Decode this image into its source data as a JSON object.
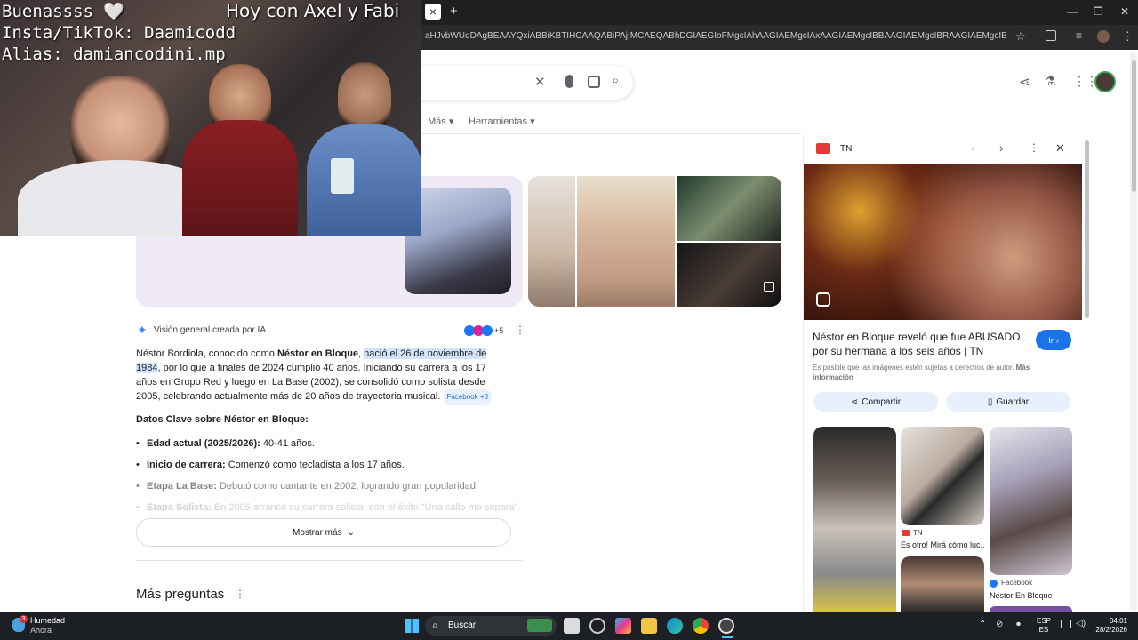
{
  "stream_overlay": {
    "line1": "Buenassss 🤍",
    "line2": "Insta/TikTok: Daamicodd",
    "line3": "Alias: damiancodini.mp",
    "title": "Hoy con Axel y Fabi"
  },
  "browser": {
    "new_tab": "+",
    "close_tab": "×",
    "url": "aHJvbWUqDAgBEAAYQxiABBiKBTIHCAAQABiPAjIMCAEQABhDGIAEGIoFMgcIAhAAGIAEMgcIAxAAGIAEMgcIBBAAGIAEMgcIBRAAGIAEMgcIBhAuGIAEMgcIBxAA..."
  },
  "search": {
    "tabs": [
      "Más",
      "Herramientas"
    ]
  },
  "ai_overview": {
    "header": "Visión general creada por IA",
    "sources_count": "+5",
    "para_part1": "Néstor Bordiola, conocido como ",
    "para_bold": "Néstor en Bloque",
    "para_part2": ", ",
    "para_highlight": "nació el 26 de noviembre de 1984",
    "para_part3": ", por lo que a finales de 2024 cumplió 40 años. Iniciando su carrera a los 17 años en Grupo Red y luego en La Base (2002), se consolidó como solista desde 2005, celebrando actualmente más de 20 años de trayectoria musical.",
    "source_chip": "Facebook +3",
    "key_title": "Datos Clave sobre Néstor en Bloque:",
    "bullets": [
      {
        "label": "Edad actual (2025/2026):",
        "text": " 40-41 años."
      },
      {
        "label": "Inicio de carrera:",
        "text": " Comenzó como tecladista a los 17 años."
      },
      {
        "label": "Etapa La Base:",
        "text": " Debutó como cantante en 2002, logrando gran popularidad."
      },
      {
        "label": "Etapa Solista:",
        "text": " En 2005 arrancó su carrera solista, con el éxito \"Una calle me separa\"."
      }
    ],
    "show_more": "Mostrar más",
    "more_questions": "Más preguntas"
  },
  "panel": {
    "source": "TN",
    "title": "Néstor en Bloque reveló que fue ABUSADO por su hermana a los seis años | TN",
    "go_button": "Ir",
    "disclaimer": "Es posible que las imágenes estén sujetas a derechos de autor.",
    "more_info": "Más información",
    "share": "Compartir",
    "save": "Guardar",
    "related": [
      {
        "source": "TN",
        "caption": "Es otro! Mirá cómo luc..."
      },
      {
        "source": "Facebook",
        "caption": "Nestor En Bloque"
      }
    ]
  },
  "taskbar": {
    "weather_title": "Humedad",
    "weather_sub": "Ahora",
    "weather_badge": "3",
    "search_label": "Buscar",
    "lang1": "ESP",
    "lang2": "ES",
    "time": "04:01",
    "date": "28/2/2026"
  },
  "colors": {
    "accent": "#1a73e8",
    "highlight": "#d2e3fc",
    "taskbar": "#1c2024"
  }
}
